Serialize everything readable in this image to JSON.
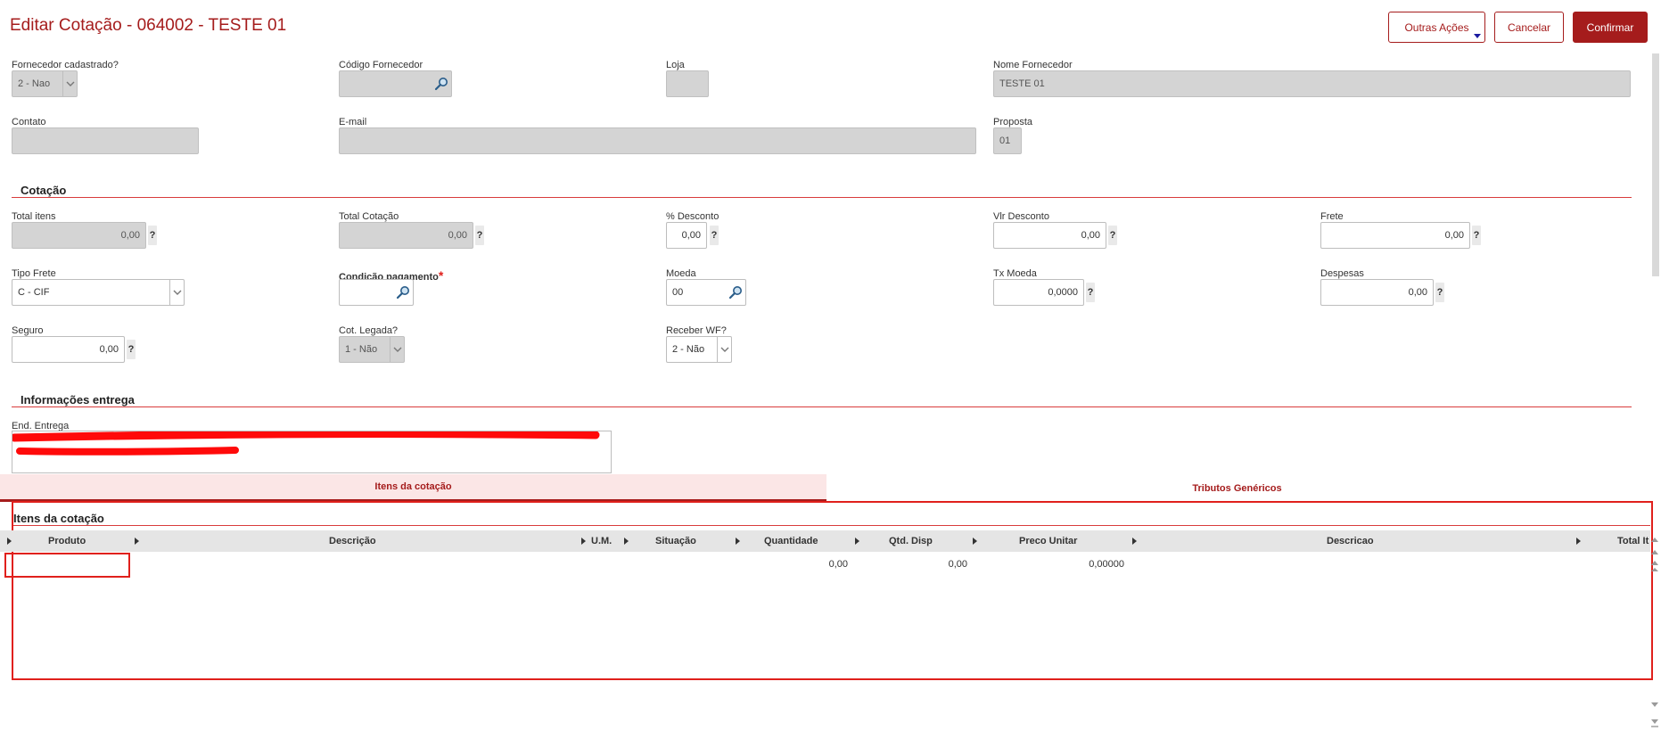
{
  "header": {
    "title": "Editar Cotação -  064002 - TESTE 01",
    "buttons": {
      "other_actions": "Outras Ações",
      "cancel": "Cancelar",
      "confirm": "Confirmar"
    }
  },
  "supplier": {
    "registered_label": "Fornecedor cadastrado?",
    "registered_value": "2 - Nao",
    "code_label": "Código Fornecedor",
    "code_value": "",
    "store_label": "Loja",
    "store_value": "",
    "name_label": "Nome Fornecedor",
    "name_value": "TESTE 01",
    "contact_label": "Contato",
    "contact_value": "",
    "email_label": "E-mail",
    "email_value": "",
    "proposal_label": "Proposta",
    "proposal_value": "01"
  },
  "quotation": {
    "section_title": "Cotação",
    "total_items_label": "Total itens",
    "total_items_value": "0,00",
    "total_quotation_label": "Total Cotação",
    "total_quotation_value": "0,00",
    "discount_pct_label": "% Desconto",
    "discount_pct_value": "0,00",
    "discount_value_label": "Vlr Desconto",
    "discount_value_value": "0,00",
    "freight_label": "Frete",
    "freight_value": "0,00",
    "freight_type_label": "Tipo Frete",
    "freight_type_value": "C - CIF",
    "payment_label": "Condição pagamento",
    "payment_required": "*",
    "payment_value": "",
    "currency_label": "Moeda",
    "currency_value": "00",
    "currency_rate_label": "Tx Moeda",
    "currency_rate_value": "0,0000",
    "expenses_label": "Despesas",
    "expenses_value": "0,00",
    "insurance_label": "Seguro",
    "insurance_value": "0,00",
    "legacy_label": "Cot. Legada?",
    "legacy_value": "1 - Não",
    "wf_label": "Receber WF?",
    "wf_value": "2 - Não",
    "help_mark": "?"
  },
  "delivery": {
    "section_title": "Informações entrega",
    "address_label": "End. Entrega"
  },
  "tabs": [
    {
      "label": "Itens da cotação",
      "active": true
    },
    {
      "label": "Tributos Genéricos",
      "active": false
    }
  ],
  "items_grid": {
    "section_title": "Itens da cotação",
    "columns": [
      "Produto",
      "Descrição",
      "U.M.",
      "Situação",
      "Quantidade",
      "Qtd. Disp",
      "Preco Unitar",
      "Descricao",
      "Total It"
    ],
    "rows": [
      {
        "produto": "",
        "descricao": "",
        "um": "",
        "situacao": "",
        "quantidade": "0,00",
        "qtd_disp": "0,00",
        "preco_unitario": "0,00000",
        "descricao2": "",
        "total": ""
      }
    ]
  },
  "colors": {
    "brand": "#a51c1c",
    "rule": "#d93c3c",
    "highlight": "#e0201c",
    "readonly": "#d4d4d4"
  }
}
